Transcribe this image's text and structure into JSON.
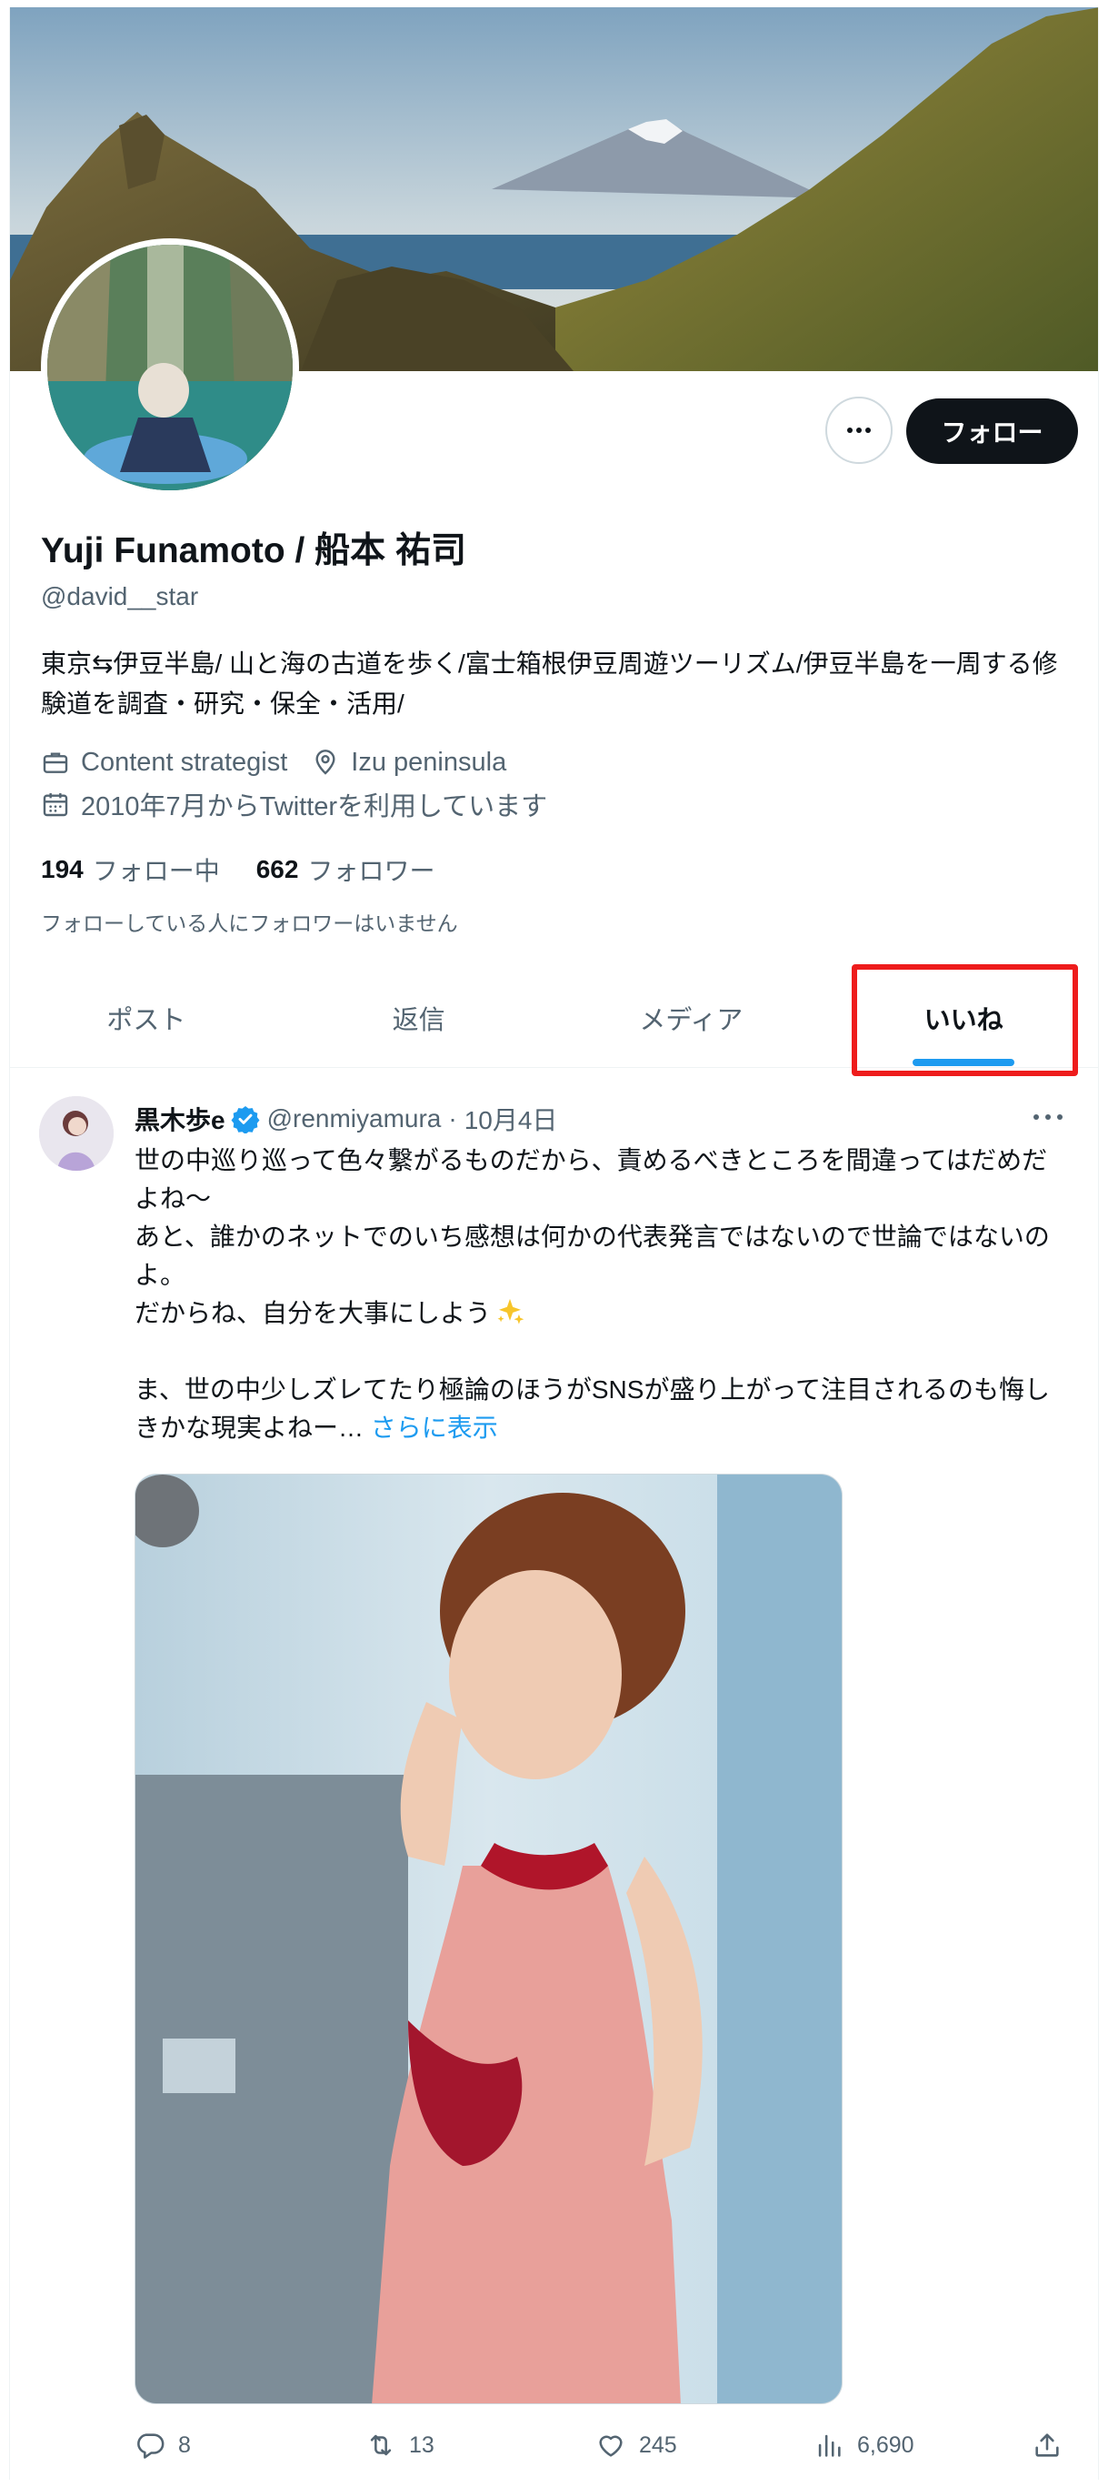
{
  "profile": {
    "display_name": "Yuji Funamoto / 船本 祐司",
    "handle": "@david__star",
    "bio": "東京⇆伊豆半島/ 山と海の古道を歩く/富士箱根伊豆周遊ツーリズム/伊豆半島を一周する修験道を調査・研究・保全・活用/",
    "profession": "Content strategist",
    "location": "Izu peninsula",
    "joined": "2010年7月からTwitterを利用しています",
    "following_count": "194",
    "following_label": "フォロー中",
    "followers_count": "662",
    "followers_label": "フォロワー",
    "followers_note": "フォローしている人にフォロワーはいません",
    "follow_button": "フォロー"
  },
  "tabs": [
    {
      "label": "ポスト",
      "active": false
    },
    {
      "label": "返信",
      "active": false
    },
    {
      "label": "メディア",
      "active": false
    },
    {
      "label": "いいね",
      "active": true
    }
  ],
  "tweet": {
    "author": "黒木歩e",
    "handle": "@renmiyamura",
    "separator": "·",
    "date": "10月4日",
    "lines": [
      "世の中巡り巡って色々繋がるものだから、責めるべきところを間違ってはだめだよね〜",
      "あと、誰かのネットでのいち感想は何かの代表発言ではないので世論ではないのよ。",
      "だからね、自分を大事にしよう",
      "",
      "ま、世の中少しズレてたり極論のほうがSNSが盛り上がって注目されるのも悔しきかな現実よねー…"
    ],
    "show_more": "さらに表示",
    "replies": "8",
    "reposts": "13",
    "likes": "245",
    "views": "6,690"
  },
  "colors": {
    "accent": "#1d9bf0",
    "highlight": "#ee1c1c",
    "text_primary": "#0f1419",
    "text_secondary": "#536471",
    "verified": "#1d9bf0"
  },
  "icons": {
    "profession": "briefcase-icon",
    "location": "location-pin-icon",
    "joined": "calendar-icon",
    "verified": "verified-badge-icon",
    "sparkle": "sparkles-emoji-icon",
    "reply": "reply-icon",
    "repost": "repost-icon",
    "like": "like-icon",
    "views": "views-icon",
    "share": "share-icon"
  }
}
